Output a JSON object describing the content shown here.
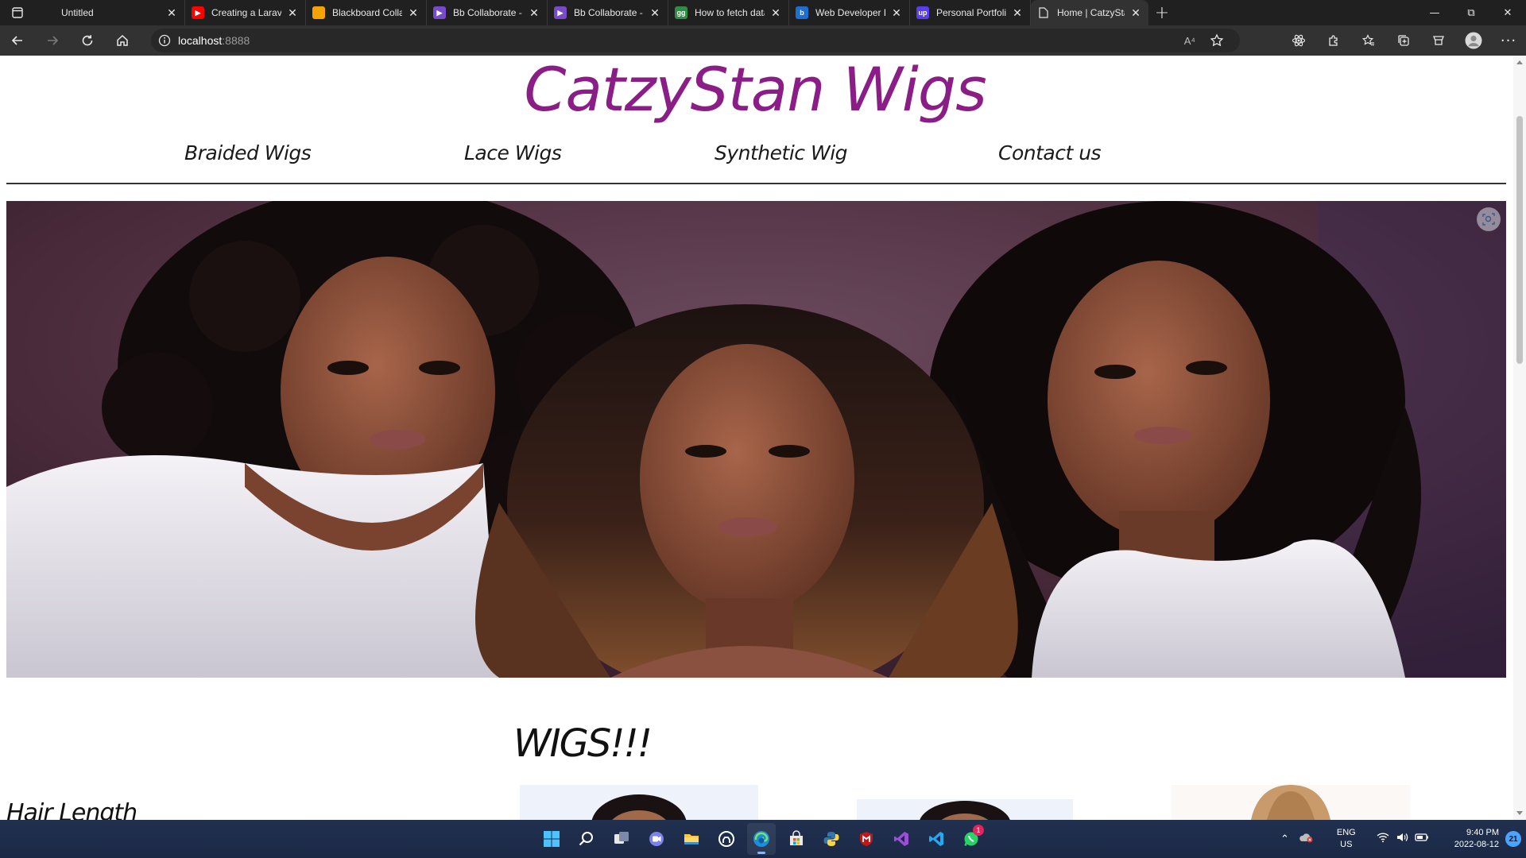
{
  "browser": {
    "tabs": [
      {
        "title": "Untitled",
        "favicon": "blank-page-icon",
        "color": "#202020"
      },
      {
        "title": "Creating a Laravel CMS",
        "favicon": "youtube-icon",
        "color": "#ff0000"
      },
      {
        "title": "Blackboard Collaborate",
        "favicon": "blackboard-icon",
        "color": "#f4a300"
      },
      {
        "title": "Bb Collaborate - Unable",
        "favicon": "bb-collaborate-icon",
        "color": "#7a4bc9"
      },
      {
        "title": "Bb Collaborate - Unable",
        "favicon": "bb-collaborate-icon",
        "color": "#7a4bc9"
      },
      {
        "title": "How to fetch data from",
        "favicon": "geeksforgeeks-icon",
        "color": "#2f8d46"
      },
      {
        "title": "Web Developer Portfolio",
        "favicon": "bing-icon",
        "color": "#1f6fd1"
      },
      {
        "title": "Personal Portfolio Website",
        "favicon": "upwork-icon",
        "color": "#5a3df0"
      },
      {
        "title": "Home | CatzyStan Wigs",
        "favicon": "page-icon",
        "color": "#323232",
        "active": true
      }
    ],
    "url_host": "localhost",
    "url_port": ":8888",
    "read_aloud_label": "A⁴"
  },
  "site": {
    "title": "CatzyStan Wigs",
    "title_color": "#8a1e86",
    "nav": [
      "Braided Wigs",
      "Lace Wigs",
      "Synthetic Wig",
      "Contact us"
    ],
    "section_title": "WIGS!!!",
    "filter_title": "Hair Length"
  },
  "taskbar": {
    "apps": [
      "windows-start-icon",
      "search-icon",
      "task-view-icon",
      "teams-chat-icon",
      "file-explorer-icon",
      "github-desktop-icon",
      "edge-icon",
      "microsoft-store-icon",
      "python-icon",
      "mcafee-icon",
      "visual-studio-icon",
      "vscode-icon",
      "whatsapp-icon"
    ],
    "whatsapp_badge": "1",
    "lang_line1": "ENG",
    "lang_line2": "US",
    "time": "9:40 PM",
    "date": "2022-08-12",
    "notification_count": "21"
  }
}
